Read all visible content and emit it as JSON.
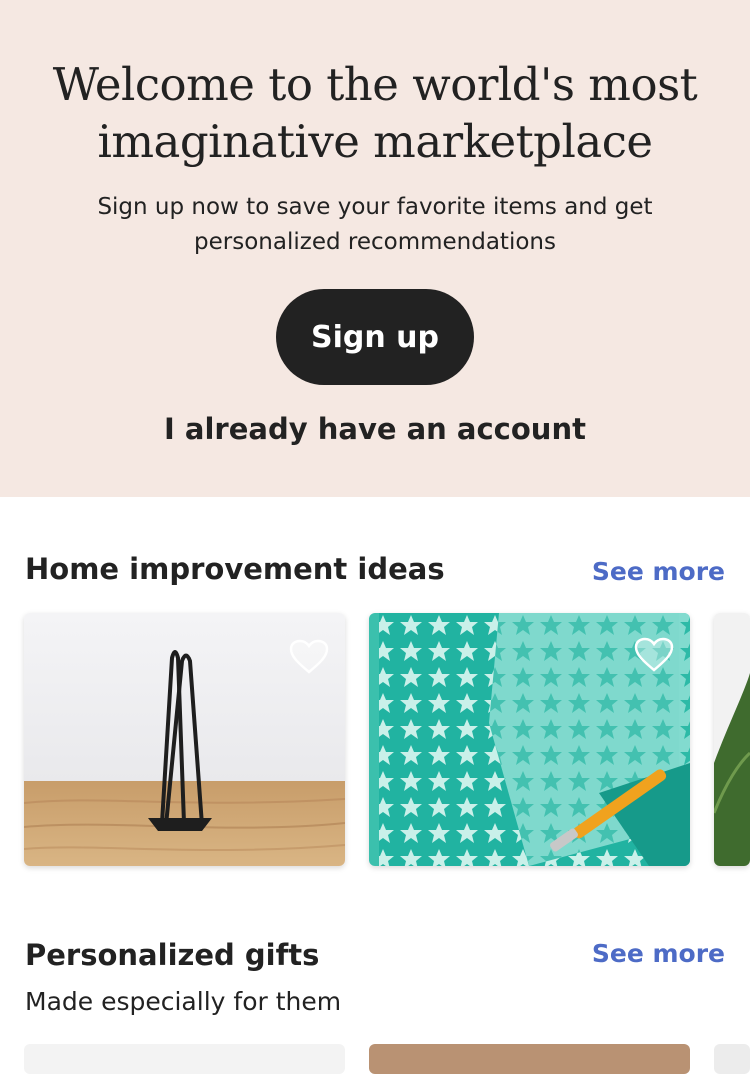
{
  "hero": {
    "title_line1": "Welcome to the world's most",
    "title_line2": "imaginative marketplace",
    "subtitle_line1": "Sign up now to save your favorite items and get",
    "subtitle_line2": "personalized recommendations",
    "signup_label": "Sign up",
    "account_label": "I already have an account"
  },
  "sections": [
    {
      "title": "Home improvement ideas",
      "see_more": "See more",
      "items": [
        {
          "image": "hairpin-table-leg",
          "favorite_icon": "heart-outline-icon"
        },
        {
          "image": "star-pattern-stencil",
          "favorite_icon": "heart-outline-icon"
        },
        {
          "image": "green-plant-leaf"
        }
      ]
    },
    {
      "title": "Personalized gifts",
      "subtitle": "Made especially for them",
      "see_more": "See more"
    }
  ],
  "colors": {
    "hero_bg": "#f5e8e2",
    "button_bg": "#222222",
    "link": "#4d6bc6"
  }
}
